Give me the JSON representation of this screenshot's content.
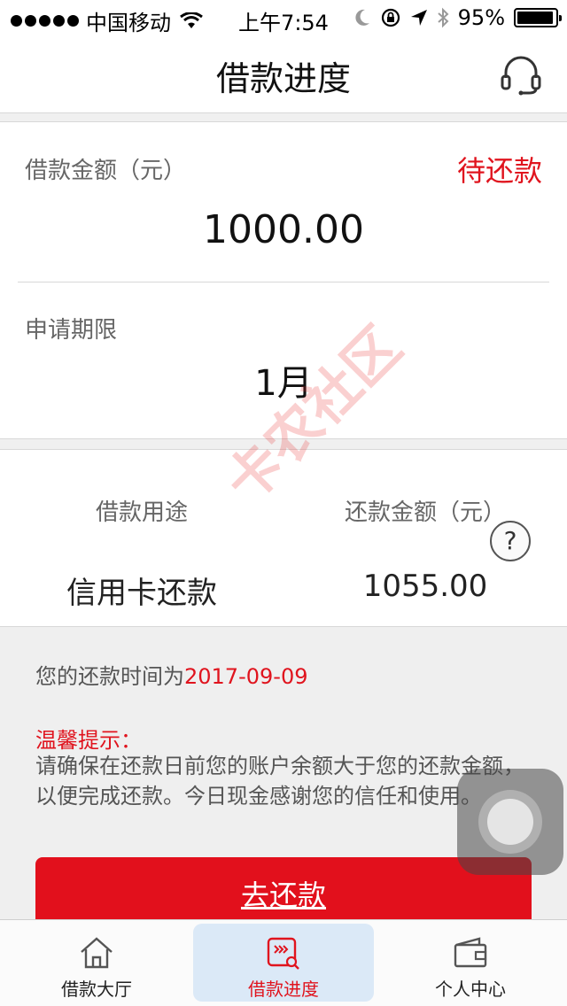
{
  "status_bar": {
    "carrier": "中国移动",
    "time": "上午7:54",
    "battery": "95%",
    "battery_level": 0.95
  },
  "header": {
    "title": "借款进度",
    "support_icon": "headset-icon"
  },
  "loan": {
    "amount_label": "借款金额（元）",
    "status": "待还款",
    "amount": "1000.00",
    "period_label": "申请期限",
    "period": "1月"
  },
  "details": {
    "purpose_label": "借款用途",
    "purpose": "信用卡还款",
    "repay_amount_label": "还款金额（元）",
    "repay_amount": "1055.00",
    "help": "?"
  },
  "notice": {
    "repay_time_prefix": "您的还款时间为",
    "repay_date": "2017-09-09",
    "tip_title": "温馨提示：",
    "tip_body": "请确保在还款日前您的账户余额大于您的还款金额，以便完成还款。今日现金感谢您的信任和使用。"
  },
  "action": {
    "repay_button": "去还款"
  },
  "watermark": "卡农社区",
  "tabs": [
    {
      "label": "借款大厅",
      "icon": "home-icon",
      "active": false
    },
    {
      "label": "借款进度",
      "icon": "progress-icon",
      "active": true
    },
    {
      "label": "个人中心",
      "icon": "wallet-icon",
      "active": false
    }
  ],
  "colors": {
    "accent_red": "#e2101c",
    "active_tab_bg": "#dbe9f7"
  }
}
